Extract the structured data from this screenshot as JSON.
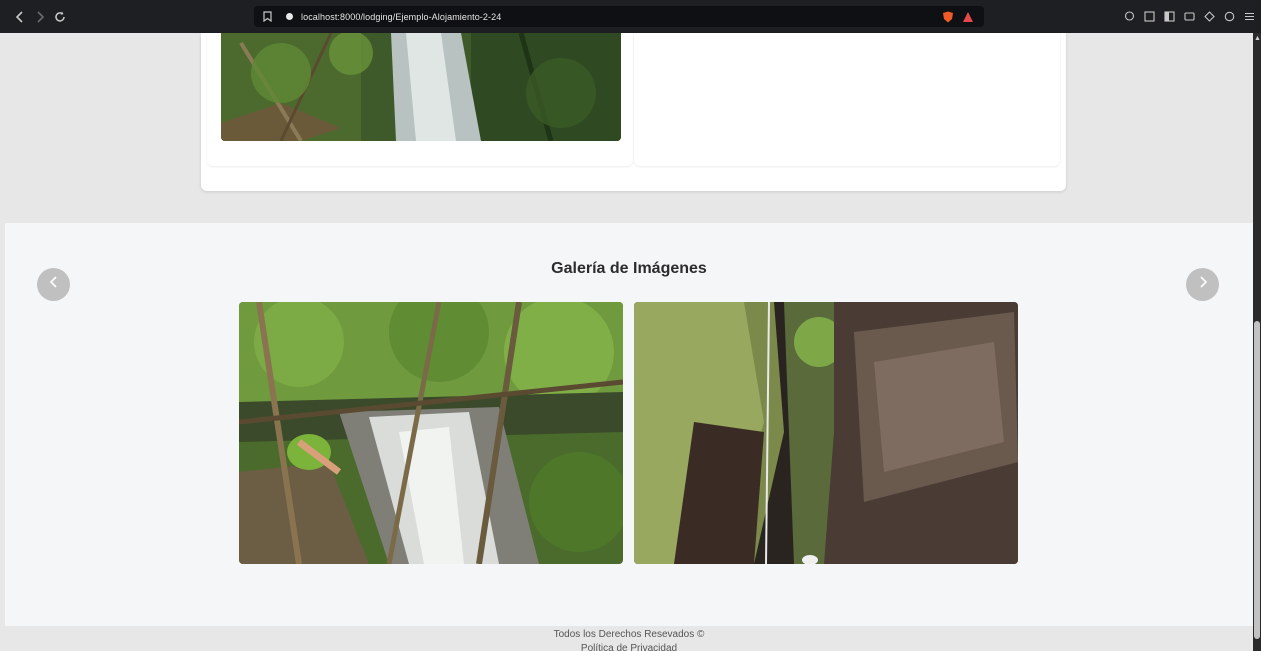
{
  "browser": {
    "url": "localhost:8000/lodging/Ejemplo-Alojamiento-2-24"
  },
  "gallery": {
    "title": "Galería de Imágenes",
    "prev_icon": "chevron-left-icon",
    "next_icon": "chevron-right-icon",
    "images": [
      {
        "alt": "waterfall-forest-photo"
      },
      {
        "alt": "mossy-canyon-photo"
      }
    ]
  },
  "footer": {
    "rights": "Todos los Derechos Resevados ©",
    "privacy": "Política de Privacidad"
  },
  "colors": {
    "page_bg": "#e7e7e7",
    "gallery_bg": "#f5f6f7",
    "browser_bar": "#1e1f22",
    "carousel_button": "#c0c0c0"
  }
}
